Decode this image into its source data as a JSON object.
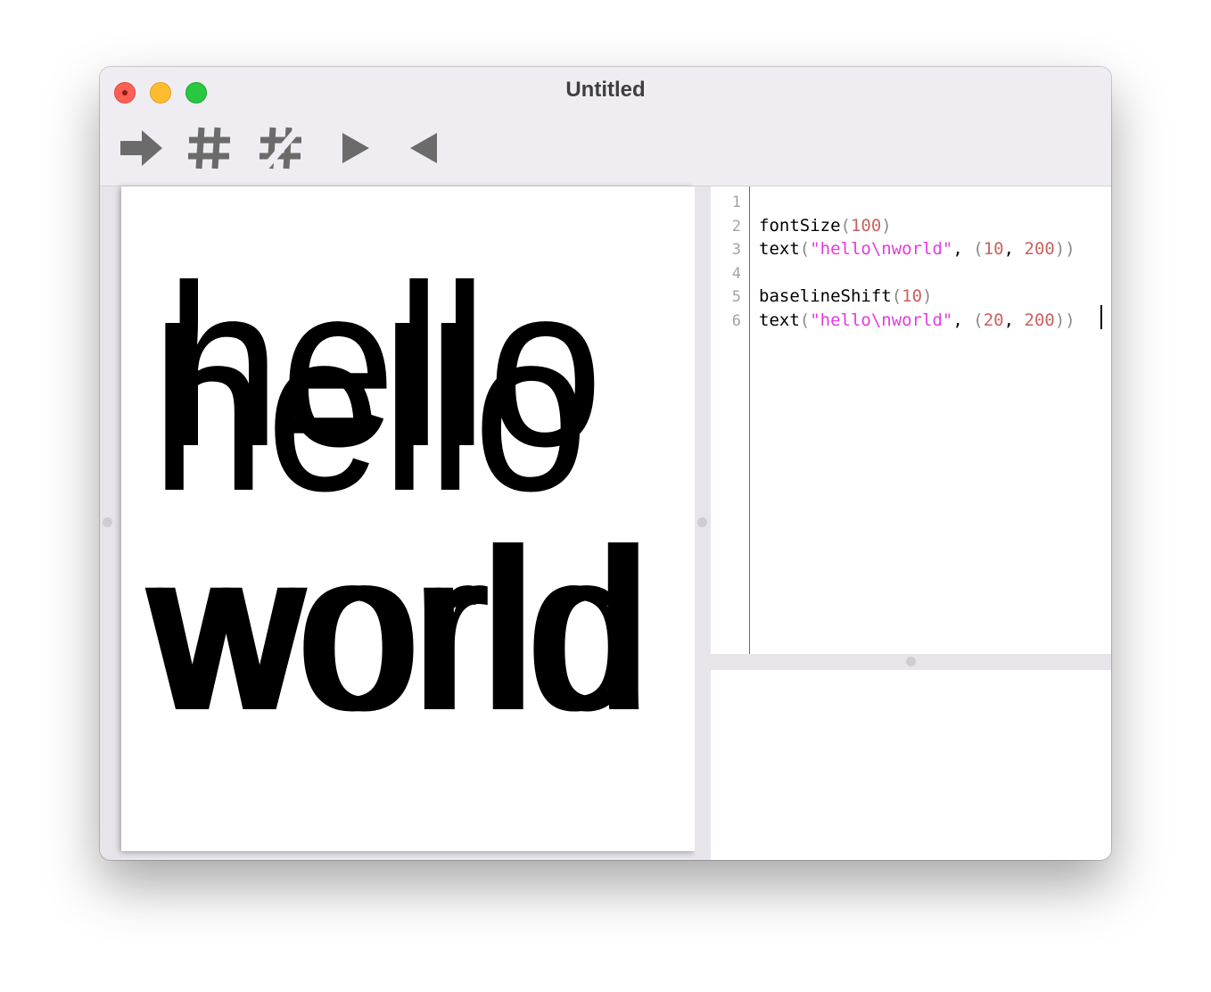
{
  "window": {
    "title": "Untitled"
  },
  "toolbar": {
    "run_icon": "arrow-right-icon",
    "comment_icon": "hash-icon",
    "uncomment_icon": "hash-crossed-icon",
    "indent_icon": "triangle-right-icon",
    "dedent_icon": "triangle-left-icon"
  },
  "canvas": {
    "texts": [
      {
        "line1": "hello",
        "line2": "world"
      },
      {
        "line1": "hello",
        "line2": "world"
      }
    ]
  },
  "editor": {
    "line_numbers": [
      "1",
      "2",
      "3",
      "4",
      "5",
      "6"
    ],
    "lines": [
      [],
      [
        {
          "t": "fontSize",
          "c": "plain"
        },
        {
          "t": "(",
          "c": "paren"
        },
        {
          "t": "100",
          "c": "num"
        },
        {
          "t": ")",
          "c": "paren"
        }
      ],
      [
        {
          "t": "text",
          "c": "plain"
        },
        {
          "t": "(",
          "c": "paren"
        },
        {
          "t": "\"hello\\nworld\"",
          "c": "str"
        },
        {
          "t": ", ",
          "c": "plain"
        },
        {
          "t": "(",
          "c": "paren"
        },
        {
          "t": "10",
          "c": "num"
        },
        {
          "t": ", ",
          "c": "plain"
        },
        {
          "t": "200",
          "c": "num"
        },
        {
          "t": "))",
          "c": "paren"
        }
      ],
      [],
      [
        {
          "t": "baselineShift",
          "c": "plain"
        },
        {
          "t": "(",
          "c": "paren"
        },
        {
          "t": "10",
          "c": "num"
        },
        {
          "t": ")",
          "c": "paren"
        }
      ],
      [
        {
          "t": "text",
          "c": "plain"
        },
        {
          "t": "(",
          "c": "paren"
        },
        {
          "t": "\"hello\\nworld\"",
          "c": "str"
        },
        {
          "t": ", ",
          "c": "plain"
        },
        {
          "t": "(",
          "c": "paren"
        },
        {
          "t": "20",
          "c": "num"
        },
        {
          "t": ", ",
          "c": "plain"
        },
        {
          "t": "200",
          "c": "num"
        },
        {
          "t": "))",
          "c": "paren"
        }
      ]
    ]
  },
  "colors": {
    "string": "#e23ce0",
    "number": "#c9625e",
    "paren": "#8a8a8a",
    "icon": "#6b6b6b"
  }
}
